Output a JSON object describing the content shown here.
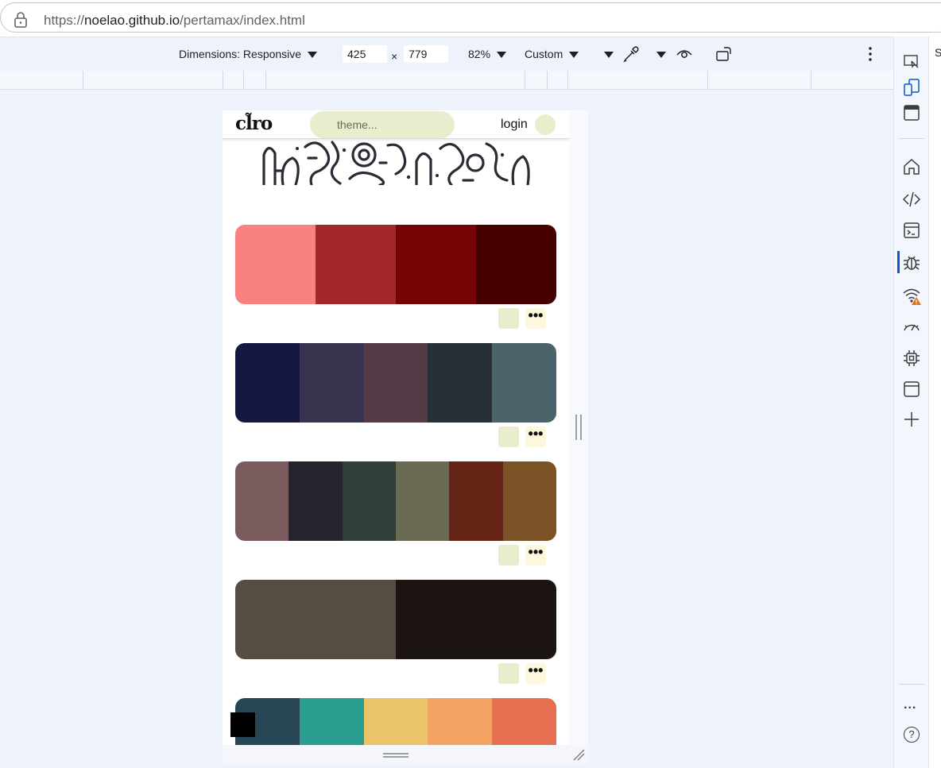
{
  "browser": {
    "url_prefix": "https://",
    "url_host": "noelao.github.io",
    "url_path": "/pertamax/index.html"
  },
  "device_toolbar": {
    "dimensions_label": "Dimensions: Responsive",
    "width": "425",
    "times": "×",
    "height": "779",
    "zoom": "82%",
    "throttle": "Custom"
  },
  "site": {
    "logo": "cl̃ro",
    "theme_placeholder": "theme...",
    "login_label": "login",
    "palette_more_label": "•••"
  },
  "palettes": [
    [
      "#f98281",
      "#a3282a",
      "#760406",
      "#460000"
    ],
    [
      "#161842",
      "#383450",
      "#533a46",
      "#283037",
      "#4b636b"
    ],
    [
      "#7b5c5e",
      "#25242f",
      "#313f3a",
      "#6a6a55",
      "#642314",
      "#7b5126"
    ],
    [
      "#564d42",
      "#564d42",
      "#1b1411",
      "#1b1411"
    ],
    [
      "#264653",
      "#2a9d8f",
      "#e9c46a",
      "#f4a261",
      "#e76f51"
    ]
  ],
  "devtools": {
    "panel_letter": "S",
    "more_icon_label": "...",
    "help_label": "?"
  },
  "colors": {
    "accent": "#0b57d0",
    "theme_pill": "#e9edcd",
    "more_btn": "#fdf8dc",
    "warning": "#e8710a"
  }
}
